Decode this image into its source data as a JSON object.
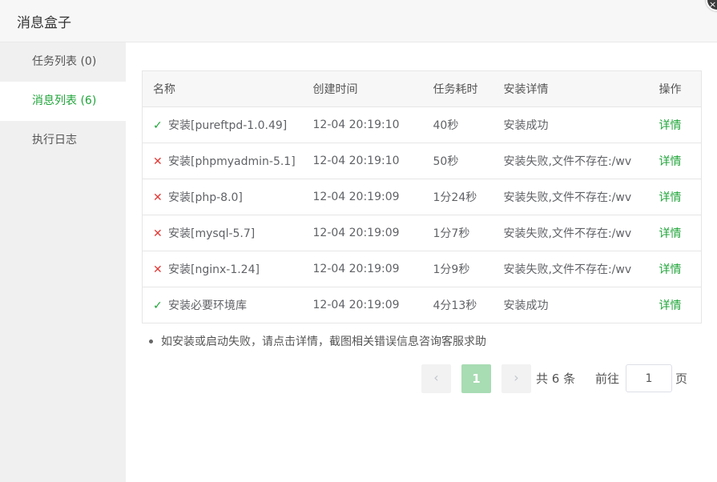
{
  "dialog": {
    "title": "消息盒子",
    "close_icon": "×"
  },
  "sidebar": {
    "items": [
      {
        "label": "任务列表 (0)"
      },
      {
        "label": "消息列表 (6)"
      },
      {
        "label": "执行日志"
      }
    ]
  },
  "table": {
    "headers": [
      "名称",
      "创建时间",
      "任务耗时",
      "安装详情",
      "操作"
    ],
    "rows": [
      {
        "status": "success",
        "name": "安装[pureftpd-1.0.49]",
        "time": "12-04 20:19:10",
        "duration": "40秒",
        "detail": "安装成功",
        "action": "详情"
      },
      {
        "status": "fail",
        "name": "安装[phpmyadmin-5.1]",
        "time": "12-04 20:19:10",
        "duration": "50秒",
        "detail": "安装失败,文件不存在:/wv",
        "action": "详情"
      },
      {
        "status": "fail",
        "name": "安装[php-8.0]",
        "time": "12-04 20:19:09",
        "duration": "1分24秒",
        "detail": "安装失败,文件不存在:/wv",
        "action": "详情"
      },
      {
        "status": "fail",
        "name": "安装[mysql-5.7]",
        "time": "12-04 20:19:09",
        "duration": "1分7秒",
        "detail": "安装失败,文件不存在:/wv",
        "action": "详情"
      },
      {
        "status": "fail",
        "name": "安装[nginx-1.24]",
        "time": "12-04 20:19:09",
        "duration": "1分9秒",
        "detail": "安装失败,文件不存在:/wv",
        "action": "详情"
      },
      {
        "status": "success",
        "name": "安装必要环境库",
        "time": "12-04 20:19:09",
        "duration": "4分13秒",
        "detail": "安装成功",
        "action": "详情"
      }
    ]
  },
  "tip": "如安装或启动失败，请点击详情，截图相关错误信息咨询客服求助",
  "pagination": {
    "prev_icon": "‹",
    "next_icon": "›",
    "current_page": "1",
    "total_text": "共 6 条",
    "goto_label": "前往",
    "goto_value": "1",
    "page_suffix": "页"
  },
  "colors": {
    "accent": "#20a53a",
    "error": "#e4393c",
    "pager_active": "#a8dcb3"
  },
  "icons": {
    "success": "✓",
    "fail": "✕"
  }
}
